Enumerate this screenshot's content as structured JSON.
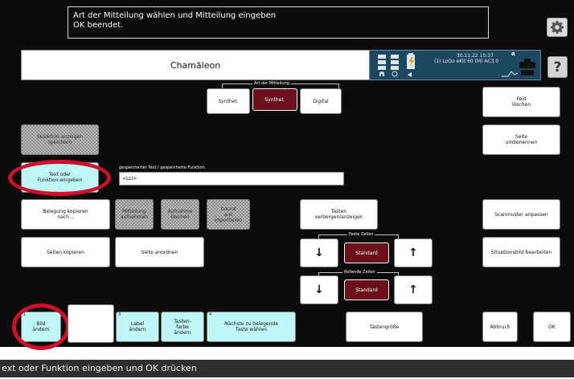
{
  "colors": {
    "background": "#0c0c0c",
    "accent_cyan": "#bff6f6",
    "accent_dark_red": "#6b0f1a",
    "highlight_red": "#d0102a",
    "status_bar": "#2f2f2f",
    "device_panel": "#1d4660"
  },
  "header": {
    "message_line1": "Art der Mitteilung wählen und Mitteilung eingeben",
    "message_line2": "OK beendet.",
    "title": "Chamäleon",
    "device_datetime": "30.11.22 10:37",
    "device_name": "(1) LoGo eKit 60 (M) AC3.0",
    "device_mode": "a",
    "settings_icon": "gear-icon",
    "help_label": "?"
  },
  "message_type": {
    "label": "Art der Mitteilung",
    "options": [
      "Synthet.",
      "Synthet.",
      "Digital"
    ],
    "selected_index": 1
  },
  "right_actions": {
    "clear_field": "Feld\nlöschen",
    "rename_page": "Seite\numbenennen",
    "adjust_pattern": "Scanmuster anpassen",
    "edit_situation": "Situationsbild bearbeiten",
    "cancel": "Abbruch",
    "ok": "OK"
  },
  "left_actions": {
    "save_selection": "Selektion anzeigen\nspeichern",
    "enter_text": "Text oder\nFunktion eingeben",
    "copy_assignment": "Belegung kopieren\nnach...",
    "copy_pages": "Seiten kopieren",
    "arrange_page": "Seite anordnen"
  },
  "stored_text": {
    "label": "gespeicherter Text / gespeicherte Funktion",
    "value": "<LLI>"
  },
  "feature_buttons": {
    "message_record": "Mitteilung\naufnehmen",
    "recording_delete": "Aufnahme\nlöschen",
    "sound_import": "Sound\naus\nimportieren"
  },
  "keys": {
    "toggle_label": "Tasten\nverbergen/anzeigen",
    "fixed_rows_label": "Feste Zeilen",
    "rolling_rows_label": "Rollende Zeilen",
    "standard": "Standard",
    "arrow_down": "↓",
    "arrow_up": "↑",
    "key_size": "Tastengröße"
  },
  "bottom_row": {
    "picture": {
      "num": "1",
      "label": "Bild\nändern"
    },
    "blank": {
      "num": "",
      "label": ""
    },
    "label_change": {
      "num": "3",
      "label": "Label\nändern"
    },
    "key_color": {
      "num": "",
      "label": "Tasten-\nfarbe\nändern"
    },
    "next_key": {
      "num": "4",
      "label": "Nächste zu belegende\nTaste wählen"
    }
  },
  "status_bar": {
    "text": "ext oder Funktion eingeben und OK drücken"
  }
}
